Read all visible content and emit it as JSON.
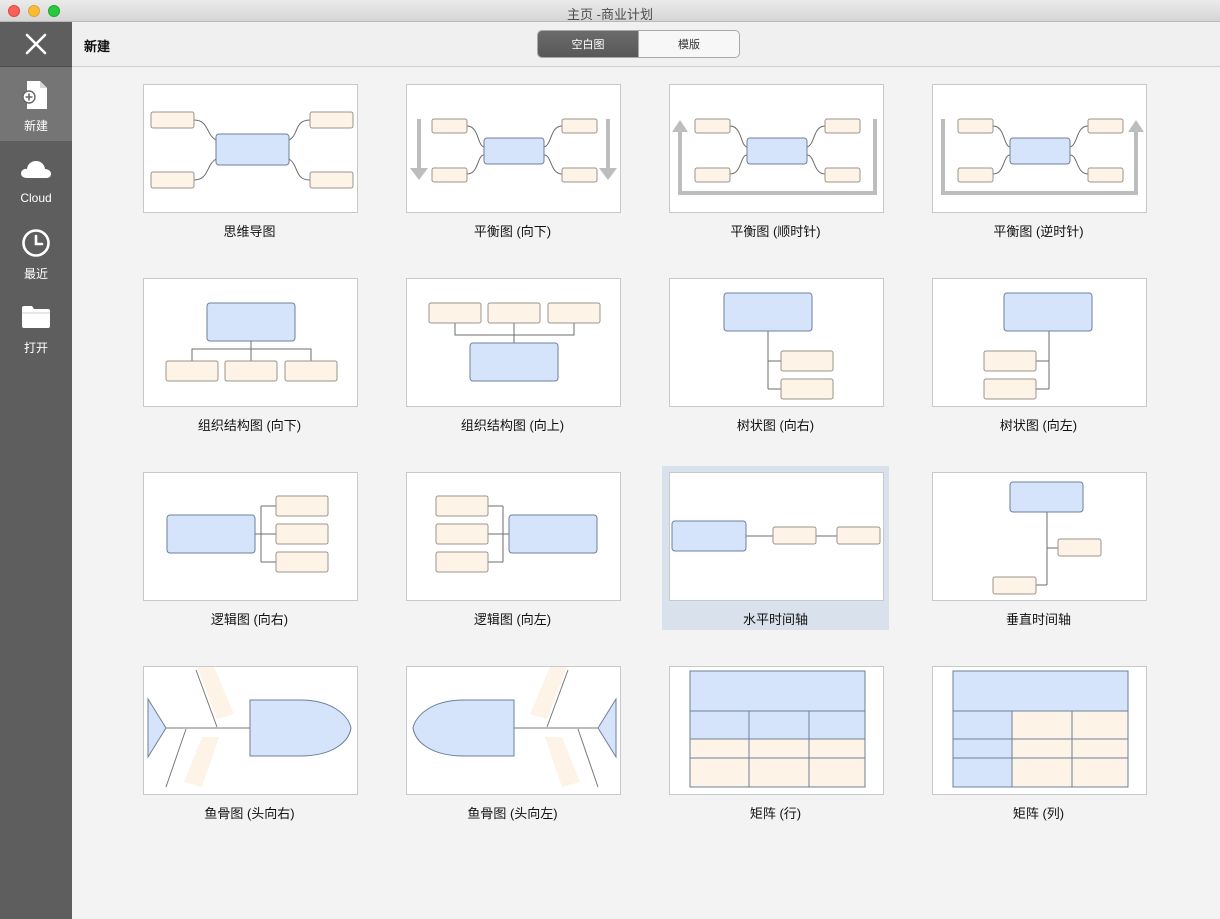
{
  "window": {
    "title": "主页 -商业计划"
  },
  "sidebar": {
    "items": [
      {
        "label": "新建",
        "icon": "new-document-icon"
      },
      {
        "label": "Cloud",
        "icon": "cloud-icon"
      },
      {
        "label": "最近",
        "icon": "clock-icon"
      },
      {
        "label": "打开",
        "icon": "folder-icon"
      }
    ]
  },
  "header": {
    "title": "新建",
    "segments": [
      "空白图",
      "模版"
    ]
  },
  "templates": [
    {
      "label": "思维导图"
    },
    {
      "label": "平衡图 (向下)"
    },
    {
      "label": "平衡图 (顺时针)"
    },
    {
      "label": "平衡图 (逆时针)"
    },
    {
      "label": "组织结构图 (向下)"
    },
    {
      "label": "组织结构图 (向上)"
    },
    {
      "label": "树状图 (向右)"
    },
    {
      "label": "树状图 (向左)"
    },
    {
      "label": "逻辑图 (向右)"
    },
    {
      "label": "逻辑图 (向左)"
    },
    {
      "label": "水平时间轴"
    },
    {
      "label": "垂直时间轴"
    },
    {
      "label": "鱼骨图 (头向右)"
    },
    {
      "label": "鱼骨图 (头向左)"
    },
    {
      "label": "矩阵 (行)"
    },
    {
      "label": "矩阵 (列)"
    }
  ],
  "colors": {
    "topic_fill": "#d5e4fb",
    "topic_stroke": "#6e7f99",
    "sub_fill": "#fdf3e6",
    "sub_stroke": "#9a948c",
    "line": "#6d6d6d",
    "selected_tile": "#d8e1ec"
  }
}
